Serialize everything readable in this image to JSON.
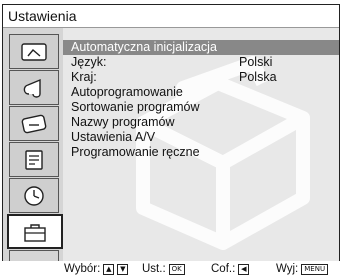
{
  "window": {
    "title": "Ustawienia"
  },
  "sidebar": {
    "tabs": [
      {
        "icon": "picture-icon"
      },
      {
        "icon": "sound-icon"
      },
      {
        "icon": "screen-icon"
      },
      {
        "icon": "features-icon"
      },
      {
        "icon": "timer-icon"
      },
      {
        "icon": "settings-toolbox-icon"
      },
      {
        "icon": ""
      }
    ],
    "selected_index": 5
  },
  "menu": {
    "items": [
      {
        "label": "Automatyczna inicjalizacja",
        "value": ""
      },
      {
        "label": "Język:",
        "value": "Polski"
      },
      {
        "label": "Kraj:",
        "value": "Polska"
      },
      {
        "label": "Autoprogramowanie",
        "value": ""
      },
      {
        "label": "Sortowanie programów",
        "value": ""
      },
      {
        "label": "Nazwy programów",
        "value": ""
      },
      {
        "label": "Ustawienia A/V",
        "value": ""
      },
      {
        "label": "Programowanie ręczne",
        "value": ""
      }
    ],
    "selected_index": 0
  },
  "footer": {
    "select_label": "Wybór:",
    "set_label": "Ust.:",
    "set_key": "OK",
    "back_label": "Cof.:",
    "exit_label": "Wyj:",
    "exit_key": "MENU"
  }
}
